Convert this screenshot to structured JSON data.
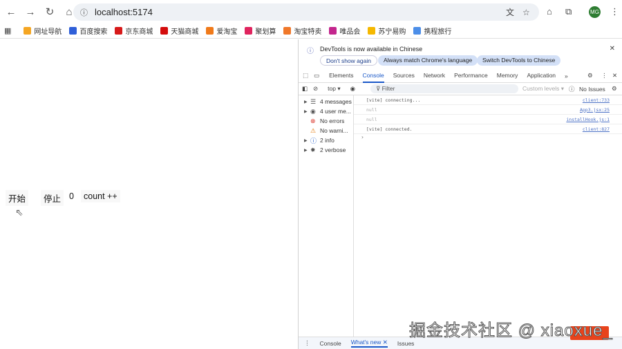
{
  "browser": {
    "url": "localhost:5174",
    "avatar": "MG"
  },
  "bookmarks": [
    {
      "label": "网址导航",
      "color": "#f5a623"
    },
    {
      "label": "百度搜索",
      "color": "#2f5fd8"
    },
    {
      "label": "京东商城",
      "color": "#d71a1a"
    },
    {
      "label": "天猫商城",
      "color": "#d40c0c"
    },
    {
      "label": "爱淘宝",
      "color": "#f07a1a"
    },
    {
      "label": "聚划算",
      "color": "#e0245e"
    },
    {
      "label": "淘宝特卖",
      "color": "#f0782a"
    },
    {
      "label": "唯品会",
      "color": "#c3268d"
    },
    {
      "label": "苏宁易购",
      "color": "#f5b800"
    },
    {
      "label": "携程旅行",
      "color": "#4c8ee8"
    }
  ],
  "page": {
    "start": "开始",
    "stop": "停止",
    "count": "0",
    "increment": "count ++"
  },
  "devtools": {
    "banner": {
      "text": "DevTools is now available in Chinese",
      "dont_show": "Don't show again",
      "match": "Always match Chrome's language",
      "switch": "Switch DevTools to Chinese"
    },
    "tabs": [
      "Elements",
      "Console",
      "Sources",
      "Network",
      "Performance",
      "Memory",
      "Application"
    ],
    "active_tab": "Console",
    "toolbar": {
      "context": "top ▾",
      "filter": "Filter",
      "levels": "Custom levels ▾",
      "issues": "No Issues"
    },
    "sidebar": [
      {
        "label": "4 messages",
        "icon": "list-icon",
        "glyph": "☰",
        "color": "#555",
        "arrow": true
      },
      {
        "label": "4 user me...",
        "icon": "user-icon",
        "glyph": "◉",
        "color": "#555",
        "arrow": true
      },
      {
        "label": "No errors",
        "icon": "error-icon",
        "glyph": "⊗",
        "color": "#d93025",
        "arrow": false
      },
      {
        "label": "No warni...",
        "icon": "warning-icon",
        "glyph": "⚠",
        "color": "#e37400",
        "arrow": false
      },
      {
        "label": "2 info",
        "icon": "info-icon",
        "glyph": "ⓘ",
        "color": "#1a58c8",
        "arrow": true
      },
      {
        "label": "2 verbose",
        "icon": "bug-icon",
        "glyph": "✹",
        "color": "#555",
        "arrow": true
      }
    ],
    "logs": [
      {
        "msg": "[vite] connecting...",
        "src": "client:733",
        "dim": false
      },
      {
        "msg": "null",
        "src": "App3.jsx:25",
        "dim": true
      },
      {
        "msg": "null",
        "src": "installHook.js:1",
        "dim": true
      },
      {
        "msg": "[vite] connected.",
        "src": "client:827",
        "dim": false
      }
    ],
    "drawer": {
      "console": "Console",
      "whats_new": "What's new",
      "issues": "Issues"
    }
  },
  "watermark": "掘金技术社区 @ xiaoxue_"
}
